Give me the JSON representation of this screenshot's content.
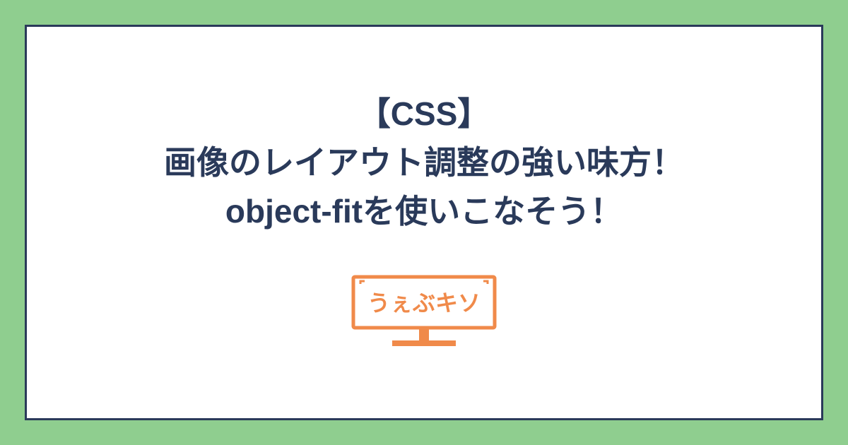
{
  "title": {
    "line1": "【CSS】",
    "line2": "画像のレイアウト調整の強い味方！",
    "line3": "object-fitを使いこなそう！"
  },
  "logo": {
    "text": "うぇぶキソ"
  },
  "colors": {
    "background": "#8fce8f",
    "card_bg": "#ffffff",
    "border": "#2a3a5a",
    "text": "#2a3a5a",
    "accent": "#f08a4a"
  }
}
